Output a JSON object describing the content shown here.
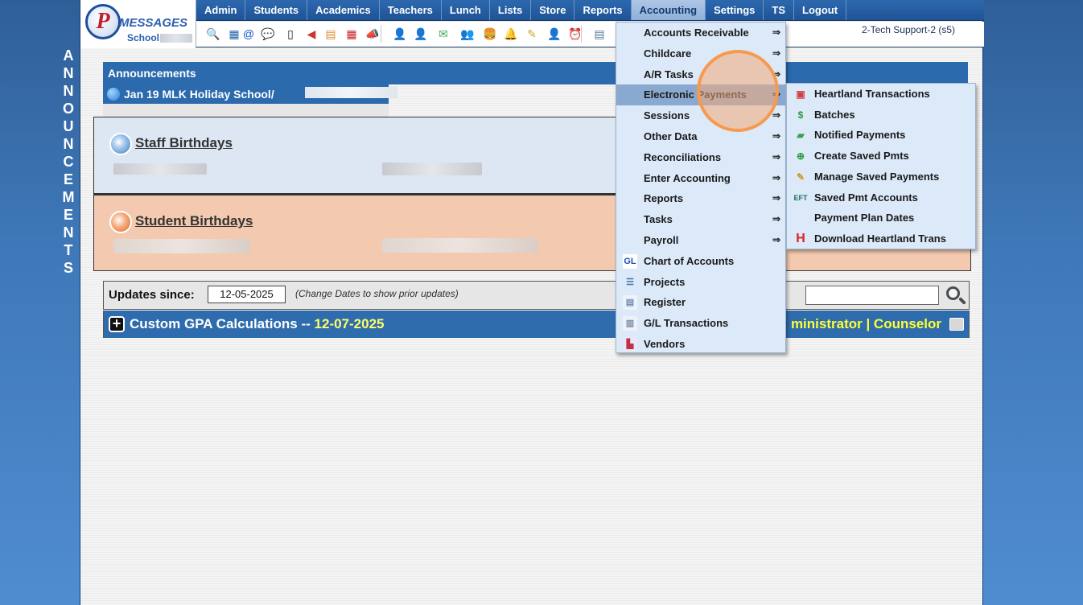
{
  "side_label": [
    "A",
    "N",
    "N",
    "O",
    "U",
    "N",
    "C",
    "E",
    "M",
    "E",
    "N",
    "T",
    "S"
  ],
  "logo": {
    "title": "MESSAGES",
    "letter": "P",
    "subtitle": "School"
  },
  "nav": {
    "items": [
      "Admin",
      "Students",
      "Academics",
      "Teachers",
      "Lunch",
      "Lists",
      "Store",
      "Reports",
      "Accounting",
      "Settings",
      "TS",
      "Logout"
    ],
    "active": "Accounting"
  },
  "user_label": "2-Tech Support-2 (s5)",
  "icons": [
    "magnifier-icon",
    "grid-icon",
    "at-icon",
    "chat-icon",
    "phone-icon",
    "megaphone-icon",
    "calendar-grid-icon",
    "calendar-icon",
    "bullhorn-icon",
    "person-add-icon",
    "person-icon",
    "money-icon",
    "group-icon",
    "burger-icon",
    "bell-icon",
    "note-icon",
    "staff-icon",
    "clock-icon",
    "doc-icon"
  ],
  "announcements": {
    "header": "Announcements",
    "item": "Jan 19 MLK Holiday School/"
  },
  "staff_birthdays": {
    "title": "Staff Birthdays"
  },
  "student_birthdays": {
    "title": "Student Birthdays"
  },
  "updates": {
    "label": "Updates since:",
    "date": "12-05-2025",
    "hint": "(Change Dates to show prior updates)"
  },
  "gpa": {
    "plus": "+",
    "title": "Custom GPA Calculations",
    "separator": " -- ",
    "date": "12-07-2025",
    "roles": "ministrator | Counselor"
  },
  "accounting_menu": {
    "items": [
      {
        "label": "Accounts Receivable",
        "arrow": true,
        "icon": ""
      },
      {
        "label": "Childcare",
        "arrow": true,
        "icon": ""
      },
      {
        "label": "A/R Tasks",
        "arrow": true,
        "icon": ""
      },
      {
        "label": "Electronic Payments",
        "arrow": true,
        "icon": "",
        "highlighted": true
      },
      {
        "label": "Sessions",
        "arrow": true,
        "icon": ""
      },
      {
        "label": "Other Data",
        "arrow": true,
        "icon": ""
      },
      {
        "label": "Reconciliations",
        "arrow": true,
        "icon": ""
      },
      {
        "label": "Enter Accounting",
        "arrow": true,
        "icon": ""
      },
      {
        "label": "Reports",
        "arrow": true,
        "icon": ""
      },
      {
        "label": "Tasks",
        "arrow": true,
        "icon": ""
      },
      {
        "label": "Payroll",
        "arrow": true,
        "icon": ""
      },
      {
        "label": "Chart of Accounts",
        "arrow": false,
        "icon": "GL"
      },
      {
        "label": "Projects",
        "arrow": false,
        "icon": "list"
      },
      {
        "label": "Register",
        "arrow": false,
        "icon": "register"
      },
      {
        "label": "G/L Transactions",
        "arrow": false,
        "icon": "gl-trans"
      },
      {
        "label": "Vendors",
        "arrow": false,
        "icon": "vendor"
      }
    ],
    "arrow_glyph": "⇒"
  },
  "electronic_payments_submenu": {
    "items": [
      {
        "label": "Heartland Transactions",
        "icon": "card"
      },
      {
        "label": "Batches",
        "icon": "moneybag"
      },
      {
        "label": "Notified Payments",
        "icon": "bill"
      },
      {
        "label": "Create Saved Pmts",
        "icon": "plus"
      },
      {
        "label": "Manage Saved Payments",
        "icon": "pencil"
      },
      {
        "label": "Saved Pmt Accounts",
        "icon": "EFT"
      },
      {
        "label": "Payment Plan Dates",
        "icon": ""
      },
      {
        "label": "Download Heartland Trans",
        "icon": "H"
      }
    ]
  },
  "colors": {
    "nav_bg": "#1f5496",
    "menu_bg": "#dbe9f8",
    "menu_highlight": "#8aa9d0",
    "staff_bg": "#dde7f3",
    "student_bg": "#f3c9b0",
    "gpa_bar": "#2f6cae",
    "gpa_accent": "#ffff33",
    "click_ring": "#f59a4f"
  }
}
